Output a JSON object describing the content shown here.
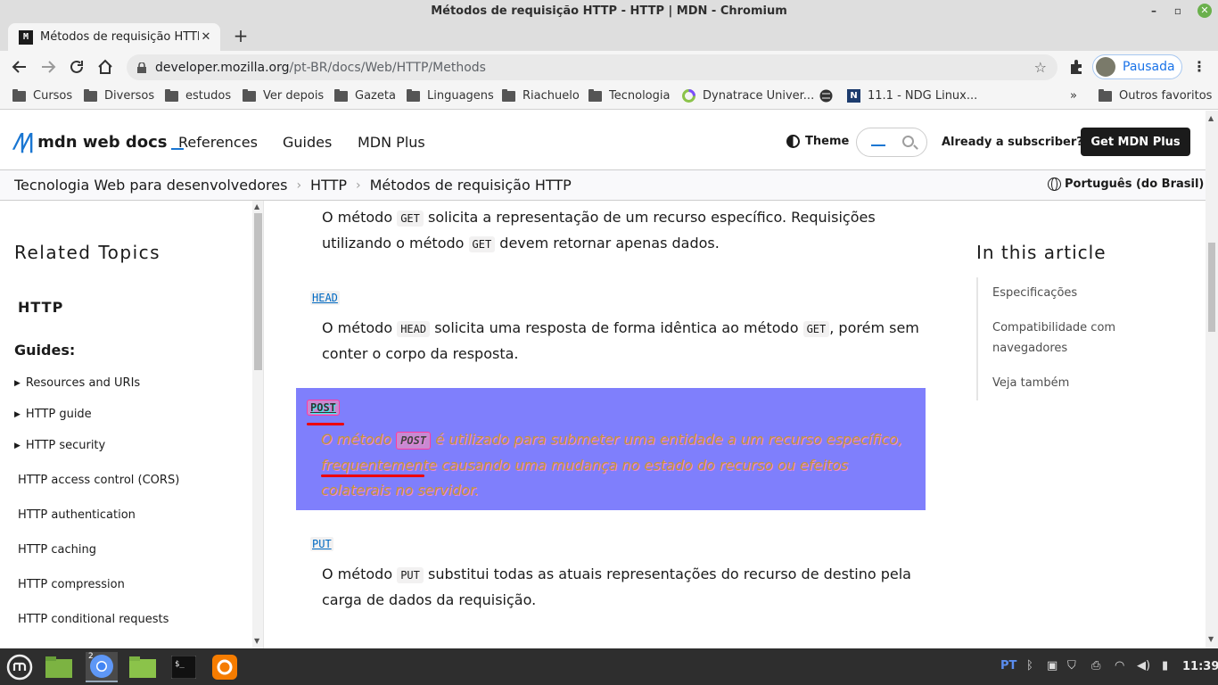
{
  "window": {
    "title": "Métodos de requisição HTTP - HTTP | MDN - Chromium"
  },
  "tab": {
    "title": "Métodos de requisição HTTP",
    "favicon": "M"
  },
  "address": {
    "host": "developer.mozilla.org",
    "path": "/pt-BR/docs/Web/HTTP/Methods"
  },
  "profile": {
    "label": "Pausada"
  },
  "bookmarks": {
    "items": [
      "Cursos",
      "Diversos",
      "estudos",
      "Ver depois",
      "Gazeta",
      "Linguagens",
      "Riachuelo",
      "Tecnologia",
      "Dynatrace Univer...",
      "11.1 - NDG Linux..."
    ],
    "overflow": "»",
    "other": "Outros favoritos"
  },
  "mdn": {
    "logo": "mdn web docs",
    "nav": [
      "References",
      "Guides",
      "MDN Plus"
    ],
    "theme": "Theme",
    "subscriber": "Already a subscriber?",
    "get_plus": "Get MDN Plus"
  },
  "breadcrumb": {
    "items": [
      "Tecnologia Web para desenvolvedores",
      "HTTP",
      "Métodos de requisição HTTP"
    ],
    "language": "Português (do Brasil)"
  },
  "sidebar": {
    "title": "Related Topics",
    "http": "HTTP",
    "guides": "Guides:",
    "expandable": [
      "Resources and URIs",
      "HTTP guide",
      "HTTP security"
    ],
    "links": [
      "HTTP access control (CORS)",
      "HTTP authentication",
      "HTTP caching",
      "HTTP compression",
      "HTTP conditional requests"
    ]
  },
  "content": {
    "get": {
      "pre": "O método ",
      "code": "GET",
      "mid": " solicita a representação de um recurso específico. Requisições utilizando o método ",
      "code2": "GET",
      "post": " devem retornar apenas dados."
    },
    "head": {
      "term": "HEAD",
      "pre": "O método ",
      "code": "HEAD",
      "mid": " solicita uma resposta de forma idêntica ao método ",
      "code2": "GET",
      "post": ", porém sem conter o corpo da resposta."
    },
    "post": {
      "term": "POST",
      "pre": "O método ",
      "code": "POST",
      "post": " é utilizado para submeter uma entidade a um recurso específico, frequentemente causando uma mudança no estado do recurso ou efeitos colaterais no servidor."
    },
    "put": {
      "term": "PUT",
      "pre": "O método ",
      "code": "PUT",
      "post": " substitui todas as atuais representações do recurso de destino pela carga de dados da requisição."
    }
  },
  "toc": {
    "title": "In this article",
    "items": [
      "Especificações",
      "Compatibilidade com navegadores",
      "Veja também"
    ]
  },
  "taskbar": {
    "badge": "2",
    "tray_lang": "PT",
    "clock": "11:39"
  },
  "colors": {
    "highlight": "#7f7ffc",
    "mdn_blue": "#1976d2",
    "link": "#0069c2"
  }
}
